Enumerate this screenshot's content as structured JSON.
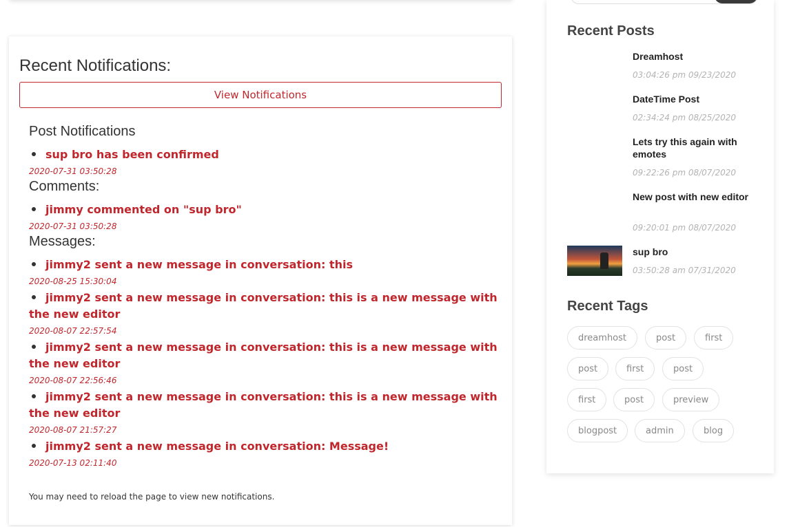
{
  "main": {
    "title": "Recent Notifications:",
    "view_button": "View Notifications",
    "sections": {
      "posts": {
        "heading": "Post Notifications",
        "items": [
          {
            "text": "sup bro has been confirmed",
            "time": "2020-07-31 03:50:28"
          }
        ]
      },
      "comments": {
        "heading": "Comments:",
        "items": [
          {
            "text": "jimmy commented on \"sup bro\"",
            "time": "2020-07-31 03:50:28"
          }
        ]
      },
      "messages": {
        "heading": "Messages:",
        "items": [
          {
            "text": "jimmy2 sent a new message in conversation: this",
            "time": "2020-08-25 15:30:04"
          },
          {
            "text": "jimmy2 sent a new message in conversation: this is a new message with the new editor",
            "time": "2020-08-07 22:57:54"
          },
          {
            "text": "jimmy2 sent a new message in conversation: this is a new message with the new editor",
            "time": "2020-08-07 22:56:46"
          },
          {
            "text": "jimmy2 sent a new message in conversation: this is a new message with the new editor",
            "time": "2020-08-07 21:57:27"
          },
          {
            "text": "jimmy2 sent a new message in conversation: Message!",
            "time": "2020-07-13 02:11:40"
          }
        ]
      }
    },
    "reload_note": "You may need to reload the page to view new notifications."
  },
  "sidebar": {
    "recent_posts_heading": "Recent Posts",
    "posts": [
      {
        "title": "Dreamhost",
        "date": "03:04:26 pm 09/23/2020"
      },
      {
        "title": "DateTime Post",
        "date": "02:34:24 pm 08/25/2020"
      },
      {
        "title": "Lets try this again with emotes",
        "date": "09:22:26 pm 08/07/2020"
      },
      {
        "title": "New post with new editor",
        "date": "09:20:01 pm 08/07/2020"
      },
      {
        "title": "sup bro",
        "date": "03:50:28 am 07/31/2020"
      }
    ],
    "recent_tags_heading": "Recent Tags",
    "tags": [
      "dreamhost",
      "post",
      "first",
      "post",
      "first",
      "post",
      "first",
      "post",
      "preview",
      "blogpost",
      "admin",
      "blog"
    ]
  },
  "colors": {
    "accent": "#c0272d",
    "muted_date": "#b3b3b3"
  }
}
